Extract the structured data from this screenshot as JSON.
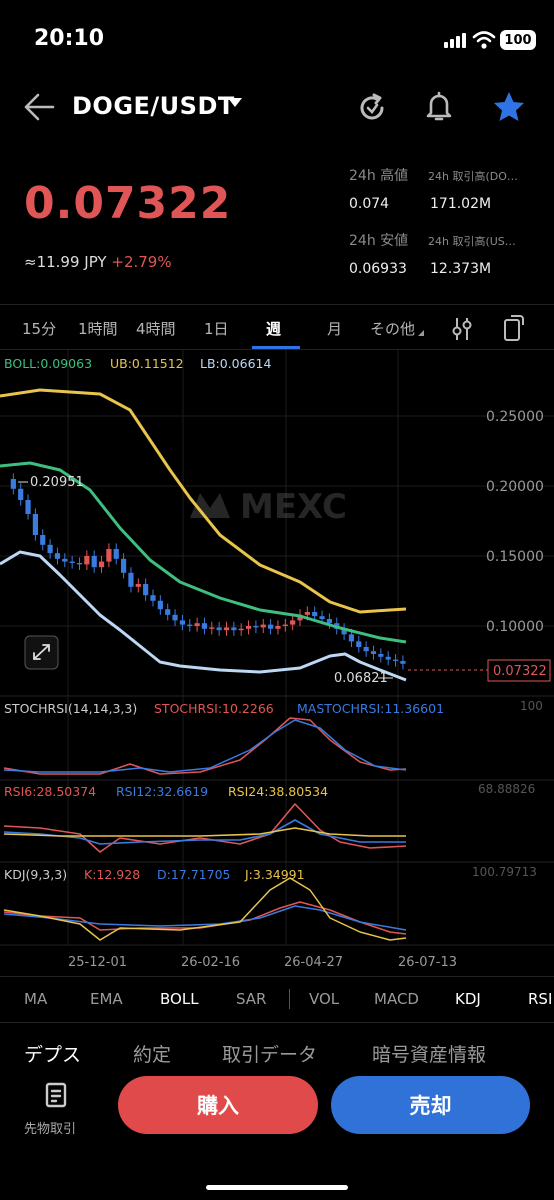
{
  "status": {
    "time": "20:10",
    "battery": "100"
  },
  "header": {
    "pair": "DOGE/USDT"
  },
  "price": {
    "last": "0.07322",
    "jpy": "≈11.99 JPY",
    "change": "+2.79%"
  },
  "stats": {
    "high_label": "24h 高値",
    "high_value": "0.074",
    "vol_base_label": "24h 取引高(DO…",
    "vol_base_value": "171.02M",
    "low_label": "24h 安値",
    "low_value": "0.06933",
    "vol_quote_label": "24h 取引高(US…",
    "vol_quote_value": "12.373M"
  },
  "timeframes": [
    "15分",
    "1時間",
    "4時間",
    "1日",
    "週",
    "月",
    "その他"
  ],
  "active_timeframe": "週",
  "chart": {
    "boll_label": "BOLL:0.09063",
    "ub_label": "UB:0.11512",
    "lb_label": "LB:0.06614",
    "axis": [
      "0.25000",
      "0.20000",
      "0.15000",
      "0.10000"
    ],
    "current_price_tag": "0.07322",
    "high_marker": "0.20951",
    "low_marker": "0.06821",
    "watermark": "MEXC",
    "stochrsi_labels": [
      "STOCHRSI(14,14,3,3)",
      "STOCHRSI:10.2266",
      "MASTOCHRSI:11.36601"
    ],
    "stochrsi_axis": "100",
    "rsi_labels": [
      "RSI6:28.50374",
      "RSI12:32.6619",
      "RSI24:38.80534"
    ],
    "rsi_axis": "68.88826",
    "kdj_labels": [
      "KDJ(9,3,3)",
      "K:12.928",
      "D:17.71705",
      "J:3.34991"
    ],
    "kdj_axis": "100.79713",
    "dates": [
      "25-12-01",
      "26-02-16",
      "26-04-27",
      "26-07-13"
    ],
    "colors": {
      "up": "#e05656",
      "down": "#3a7be0",
      "boll": "#3fbf7f",
      "ub": "#e8c44a",
      "lb": "#bcd8f5"
    }
  },
  "indicator_tabs": [
    "MA",
    "EMA",
    "BOLL",
    "SAR",
    "VOL",
    "MACD",
    "KDJ",
    "RSI"
  ],
  "bottom_tabs": [
    "デプス",
    "約定",
    "取引データ",
    "暗号資産情報"
  ],
  "actions": {
    "futures": "先物取引",
    "buy": "購入",
    "sell": "売却"
  }
}
